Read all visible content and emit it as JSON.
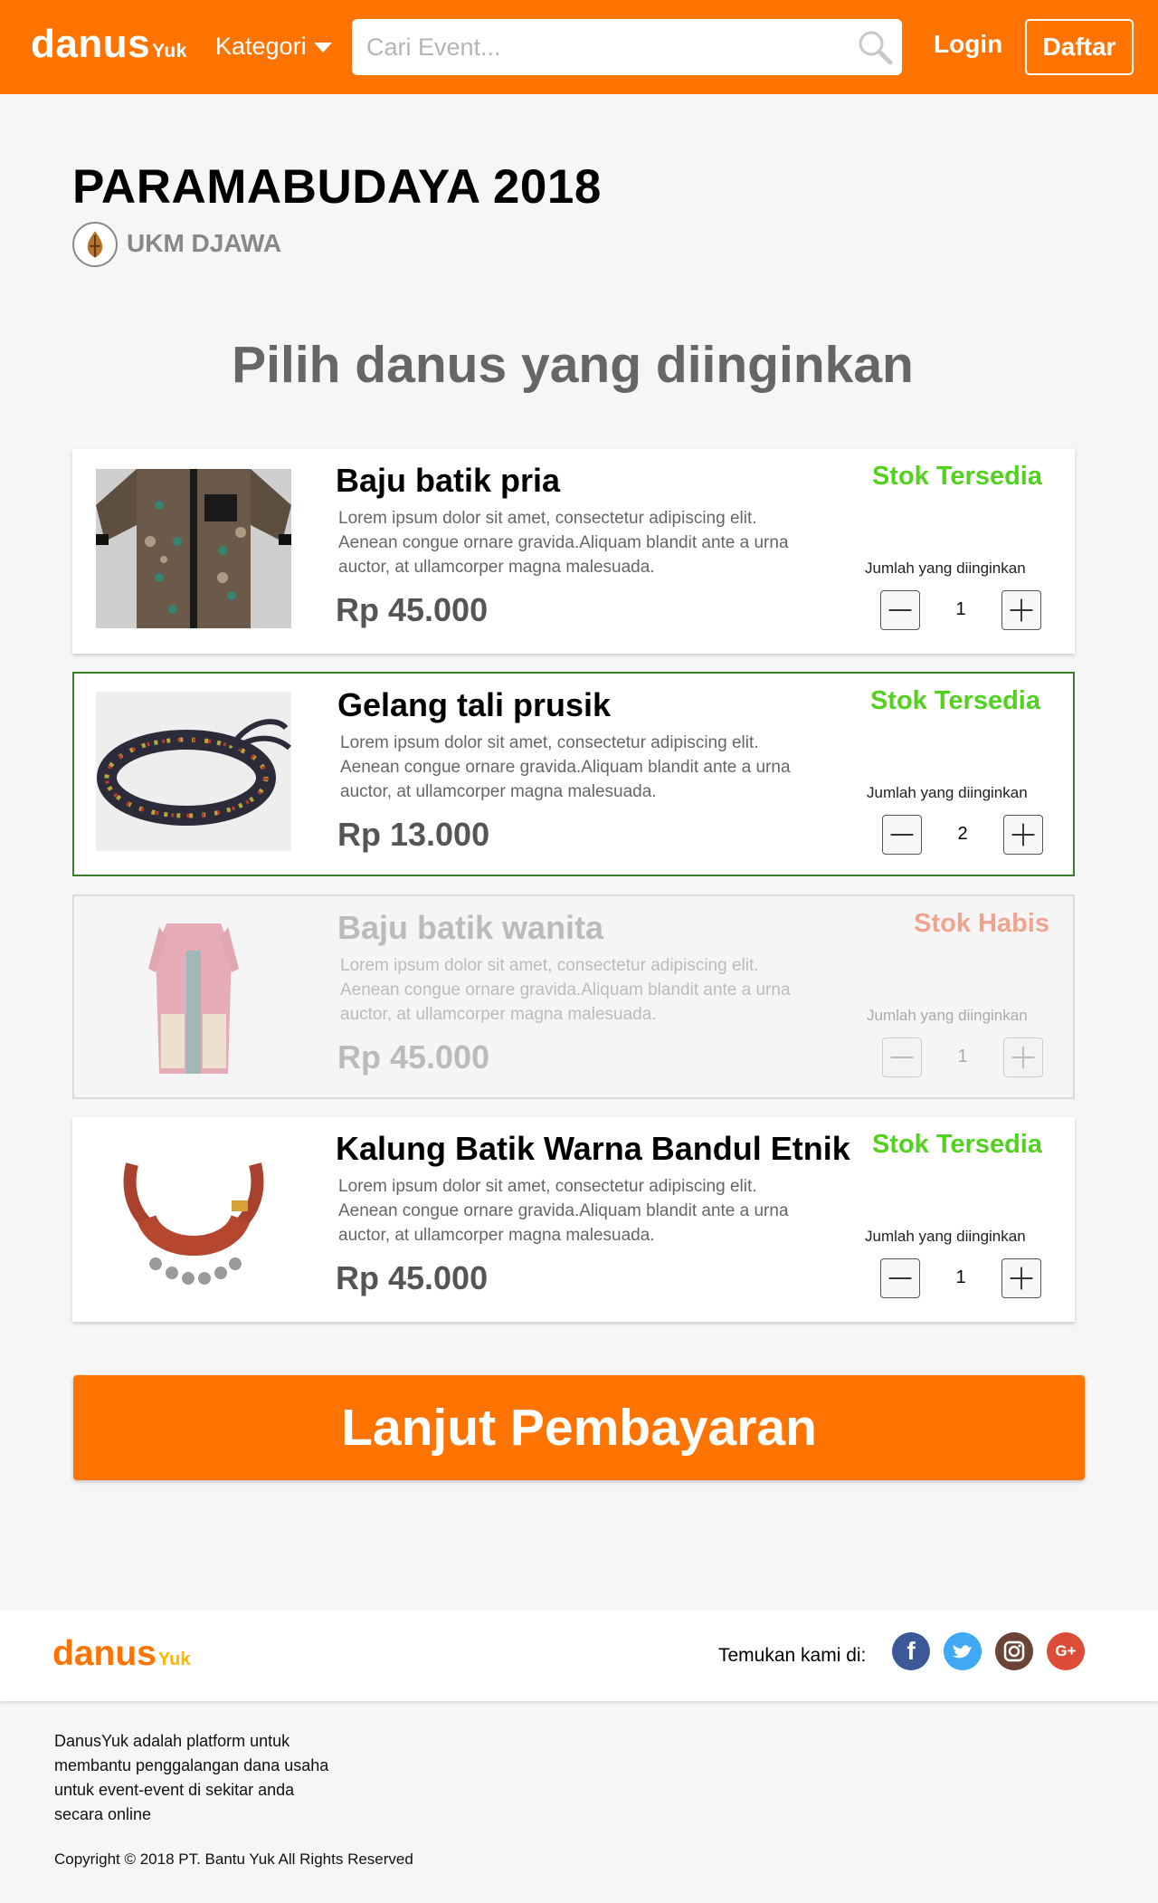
{
  "header": {
    "logo_main": "danus",
    "logo_sub": "Yuk",
    "kategori_label": "Kategori",
    "search_placeholder": "Cari Event...",
    "login_label": "Login",
    "daftar_label": "Daftar",
    "brand_color": "#ff7400"
  },
  "event": {
    "title": "PARAMABUDAYA 2018",
    "organizer": "UKM DJAWA"
  },
  "section_heading": "Pilih danus yang diinginkan",
  "products": [
    {
      "name": "Baju batik pria",
      "description": "Lorem ipsum dolor sit amet, consectetur adipiscing elit. Aenean congue ornare gravida.Aliquam blandit ante a urna auctor, at ullamcorper magna malesuada.",
      "price": "Rp 45.000",
      "stock": "Stok Tersedia",
      "qty_label": "Jumlah yang diinginkan",
      "qty": "1",
      "state": "normal"
    },
    {
      "name": "Gelang tali prusik",
      "description": "Lorem ipsum dolor sit amet, consectetur adipiscing elit. Aenean congue ornare gravida.Aliquam blandit ante a urna auctor, at ullamcorper magna malesuada.",
      "price": "Rp 13.000",
      "stock": "Stok Tersedia",
      "qty_label": "Jumlah yang diinginkan",
      "qty": "2",
      "state": "selected"
    },
    {
      "name": "Baju batik wanita",
      "description": "Lorem ipsum dolor sit amet, consectetur adipiscing elit. Aenean congue ornare gravida.Aliquam blandit ante a urna auctor, at ullamcorper magna malesuada.",
      "price": "Rp 45.000",
      "stock": "Stok Habis",
      "qty_label": "Jumlah yang diinginkan",
      "qty": "1",
      "state": "disabled"
    },
    {
      "name": "Kalung Batik Warna Bandul Etnik",
      "description": "Lorem ipsum dolor sit amet, consectetur adipiscing elit. Aenean congue ornare gravida.Aliquam blandit ante a urna auctor, at ullamcorper magna malesuada.",
      "price": "Rp 45.000",
      "stock": "Stok Tersedia",
      "qty_label": "Jumlah yang diinginkan",
      "qty": "1",
      "state": "normal"
    }
  ],
  "checkout_label": "Lanjut Pembayaran",
  "footer": {
    "logo_main": "danus",
    "logo_sub": "Yuk",
    "temukan": "Temukan kami di:",
    "social": [
      {
        "name": "facebook-icon",
        "glyph": "f"
      },
      {
        "name": "twitter-icon",
        "glyph": "t"
      },
      {
        "name": "instagram-icon",
        "glyph": ""
      },
      {
        "name": "google-plus-icon",
        "glyph": "G+"
      }
    ],
    "about": "DanusYuk adalah platform untuk membantu penggalangan dana usaha untuk event-event di sekitar anda secara online",
    "copyright": "Copyright © 2018 PT. Bantu Yuk All Rights Reserved"
  }
}
